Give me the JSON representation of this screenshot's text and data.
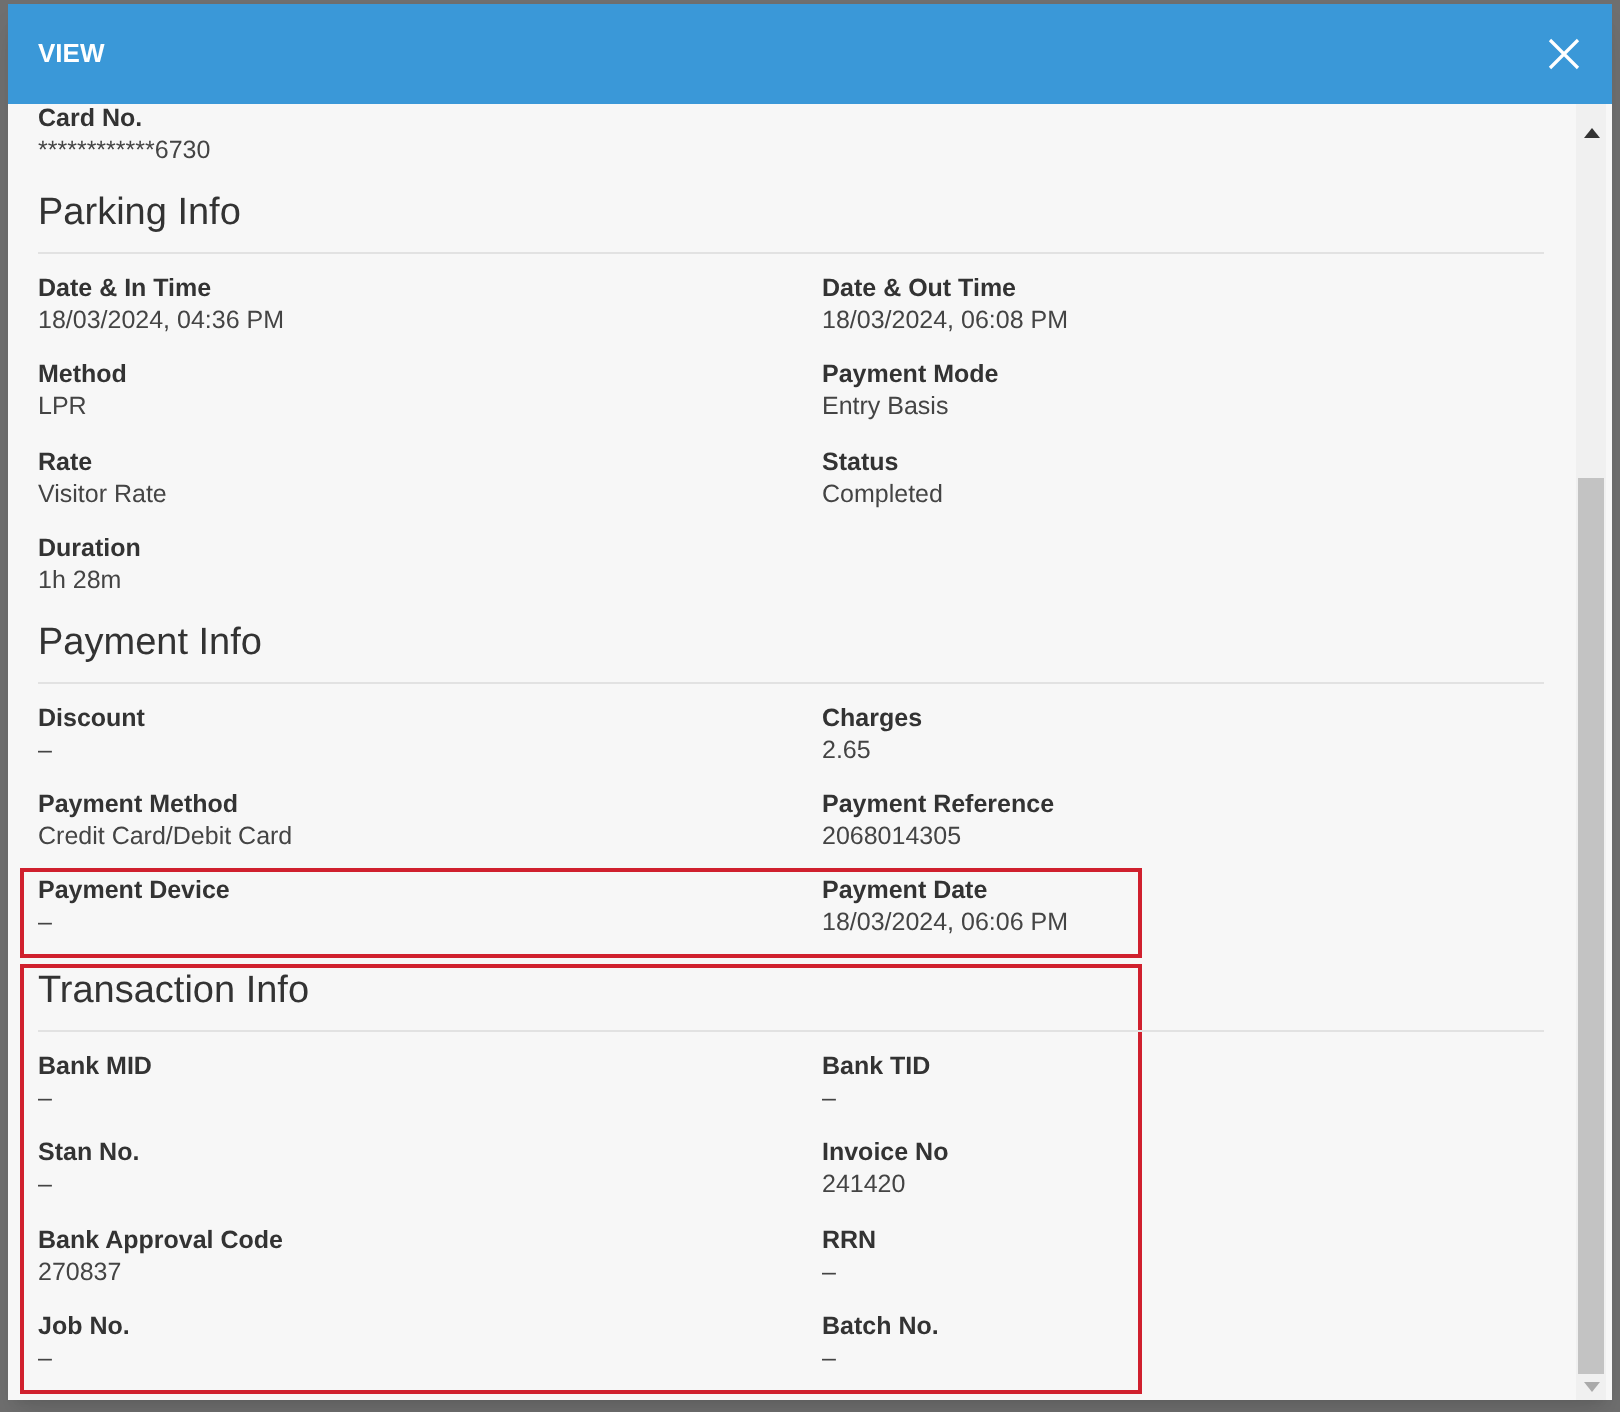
{
  "dialog": {
    "title": "VIEW"
  },
  "top_fields": [
    {
      "label": "Card No.",
      "value": "************6730"
    }
  ],
  "sections": [
    {
      "heading": "Parking Info",
      "highlighted": false,
      "fields": [
        {
          "label": "Date & In Time",
          "value": "18/03/2024, 04:36 PM",
          "highlighted": false
        },
        {
          "label": "Date & Out Time",
          "value": "18/03/2024, 06:08 PM",
          "highlighted": false
        },
        {
          "label": "Method",
          "value": "LPR",
          "highlighted": false
        },
        {
          "label": "Payment Mode",
          "value": "Entry Basis",
          "highlighted": false
        },
        {
          "label": "Rate",
          "value": "Visitor Rate",
          "highlighted": false
        },
        {
          "label": "Status",
          "value": "Completed",
          "highlighted": false
        },
        {
          "label": "Duration",
          "value": "1h 28m",
          "highlighted": false
        }
      ]
    },
    {
      "heading": "Payment Info",
      "highlighted": false,
      "fields": [
        {
          "label": "Discount",
          "value": "–",
          "highlighted": false
        },
        {
          "label": "Charges",
          "value": "2.65",
          "highlighted": false
        },
        {
          "label": "Payment Method",
          "value": "Credit Card/Debit Card",
          "highlighted": false
        },
        {
          "label": "Payment Reference",
          "value": "2068014305",
          "highlighted": false
        },
        {
          "label": "Payment Device",
          "value": "–",
          "highlighted": true
        },
        {
          "label": "Payment Date",
          "value": "18/03/2024, 06:06 PM",
          "highlighted": true
        }
      ]
    },
    {
      "heading": "Transaction Info",
      "highlighted": true,
      "fields": [
        {
          "label": "Bank MID",
          "value": "–",
          "highlighted": false
        },
        {
          "label": "Bank TID",
          "value": "–",
          "highlighted": false
        },
        {
          "label": "Stan No.",
          "value": "–",
          "highlighted": false
        },
        {
          "label": "Invoice No",
          "value": "241420",
          "highlighted": false
        },
        {
          "label": "Bank Approval Code",
          "value": "270837",
          "highlighted": false
        },
        {
          "label": "RRN",
          "value": "–",
          "highlighted": false
        },
        {
          "label": "Job No.",
          "value": "–",
          "highlighted": false
        },
        {
          "label": "Batch No.",
          "value": "–",
          "highlighted": false
        }
      ]
    }
  ]
}
